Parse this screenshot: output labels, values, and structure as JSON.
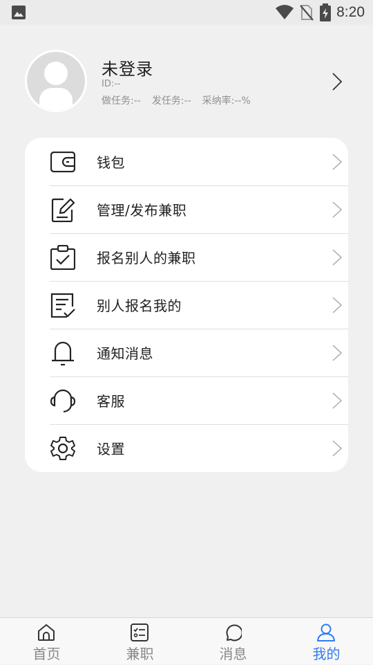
{
  "status_bar": {
    "time": "8:20"
  },
  "profile": {
    "name": "未登录",
    "id_text": "ID:--",
    "stats": [
      "做任务:--",
      "发任务:--",
      "采纳率:--%"
    ]
  },
  "menu": {
    "items": [
      {
        "label": "钱包",
        "icon": "wallet-icon"
      },
      {
        "label": "管理/发布兼职",
        "icon": "edit-document-icon"
      },
      {
        "label": "报名别人的兼职",
        "icon": "clipboard-check-icon"
      },
      {
        "label": "别人报名我的",
        "icon": "list-check-icon"
      },
      {
        "label": "通知消息",
        "icon": "bell-icon"
      },
      {
        "label": "客服",
        "icon": "headset-icon"
      },
      {
        "label": "设置",
        "icon": "gear-icon"
      }
    ]
  },
  "bottom_nav": {
    "tabs": [
      {
        "label": "首页",
        "icon": "home-icon"
      },
      {
        "label": "兼职",
        "icon": "checklist-icon"
      },
      {
        "label": "消息",
        "icon": "chat-bubble-icon"
      },
      {
        "label": "我的",
        "icon": "person-icon",
        "active": true
      }
    ]
  },
  "colors": {
    "accent": "#2e7cf6",
    "background": "#f0f0f0",
    "card": "#ffffff"
  }
}
